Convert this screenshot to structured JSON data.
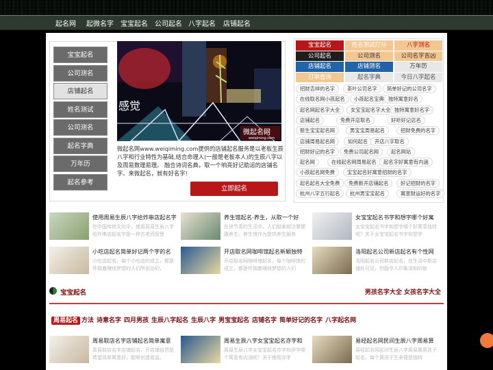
{
  "nav": {
    "items": [
      "起名网",
      "起微名字",
      "宝宝起名",
      "公司起名",
      "八字起名",
      "店铺起名"
    ]
  },
  "left_menu": {
    "items": [
      "宝宝起名",
      "公司测名",
      "店铺起名",
      "姓名测试",
      "公司测名",
      "起名字典",
      "万年历",
      "起名参考"
    ],
    "active_index": 2
  },
  "banner": {
    "text": "感觉",
    "watermark": "微起名网",
    "watermark_sub": "weiqiming.com"
  },
  "intro": {
    "text": "微起名网www.weiqiming.com提供的店铺起名服务是以老板生辰八字和行业特性为基础,结合命理人(一般是老板本人)的生辰八字以及周易数理易理。 融合诗词名典，取一个响亮好记助运的店铺名字。来微起名，就有好名字!",
    "button": "立即起名"
  },
  "right_tabs": [
    {
      "label": "宝宝起名",
      "bg": "#b71718",
      "fg": "#ffffff"
    },
    {
      "label": "姓名测试打分",
      "bg": "#f2c792",
      "fg": "#ffffff"
    },
    {
      "label": "八字测名",
      "bg": "#f2c792",
      "fg": "#b71718"
    },
    {
      "label": "公司起名",
      "bg": "#1d1d1d",
      "fg": "#ffffff"
    },
    {
      "label": "公司测名",
      "bg": "#f2c792",
      "fg": "#333333"
    },
    {
      "label": "公司名字吉凶",
      "bg": "#f2c792",
      "fg": "#333333"
    },
    {
      "label": "店铺起名",
      "bg": "#2363a7",
      "fg": "#ffffff"
    },
    {
      "label": "店铺测名",
      "bg": "#2363a7",
      "fg": "#ffffff"
    },
    {
      "label": "万年历",
      "bg": "#e8e8e8",
      "fg": "#333333"
    },
    {
      "label": "订单查询",
      "bg": "#f2c792",
      "fg": "#ffffff"
    },
    {
      "label": "起名字典",
      "bg": "#e8e8e8",
      "fg": "#555555"
    },
    {
      "label": "今日八字起名",
      "bg": "#e8e8e8",
      "fg": "#555555"
    }
  ],
  "keywords": [
    [
      "招财吉祥的名字",
      "茶叶公司名字",
      "简单好记的公司名字"
    ],
    [
      "在线取名网小孩起名",
      "小孩起名宝典",
      "独特寓意好名"
    ],
    [
      "起名网起名字大全",
      "女宝宝起名字大全",
      "独特寓意好名字"
    ],
    [
      "店铺起名",
      "免费开店取名",
      "好听好记店名"
    ],
    [
      "新生宝宝起名网",
      "男宝宝周易起名",
      "招财免费的名字"
    ],
    [
      "店铺周易起名网",
      "如何起名",
      "开店八字取名"
    ],
    [
      "招财好记的名字",
      "免费公司起名网",
      "起名网站"
    ],
    [
      "起名网",
      "在线起名网周易起名",
      "起名字好寓意有内涵"
    ],
    [
      "小孩起名网免费",
      "宝宝起名好寓意招财的名字"
    ],
    [
      "起名起名大全免费",
      "免费新开店铺起名",
      "好记招财的名字"
    ],
    [
      "杭州八字五行起名",
      "杭州男宝宝起名",
      "寓意财运好的名字"
    ]
  ],
  "articles": [
    {
      "title": "使用周易生辰八字给炸串店起名字",
      "summary": "在中国传统文化中，使用周易生辰八字给炸串店起名字是一种古老而智慧"
    },
    {
      "title": "养生馆起名-养生，从取一个好",
      "summary": "在快节奏的生活中，人们越来越注重健康养生。养生馆作为提供养生服务"
    },
    {
      "title": "女宝宝起名书字和想字哪个好寓",
      "summary": "女宝宝起名书字和想字哪个好寓意独特呢？关于女宝宝起名书字和想字"
    },
    {
      "title": "小吃店起名简单好记两个字的名",
      "summary": "小吃店起名，每个小吃店的成立，都是怀揣着赚钱梦想的人们所创办的，"
    },
    {
      "title": "开店取名网咖啡馆起名新颖独特",
      "summary": "开店取名网咖啡馆起名，每个咖啡馆的成立，都是怀揣着赚钱梦想的人们"
    },
    {
      "title": "洛阳起名公司新店起名有个性网",
      "summary": "洛阳起名公司新店起名，在生活中新店铺处可见，但能令人印象深刻的新"
    }
  ],
  "section": {
    "title": "宝宝起名",
    "right": "男孩名字大全 女孩名字大全"
  },
  "tags": [
    "周易起名",
    "方法",
    "诗意名字",
    "四月男孩",
    "生辰八字起名",
    "生辰八字",
    "男宝宝起名",
    "店铺名字",
    "简单好记的名字",
    "八字起名网"
  ],
  "articles2": [
    {
      "title": "周易取店名字店铺起名简单寓意",
      "summary": "周易取店名字店铺起名，开店铺自然是希望简单寓意好，能够创造收益。"
    },
    {
      "title": "周易生辰八字女宝宝起名亦字和",
      "summary": "周易生辰八字女宝宝起名亦字和伊字哪个寓意有内涵呢？关于使用亦字"
    },
    {
      "title": "易经起名网民间生辰八字周易算",
      "summary": "易经起名网民间生辰八字周易算男孩子起名。每个男孩子生来便是独特"
    }
  ]
}
